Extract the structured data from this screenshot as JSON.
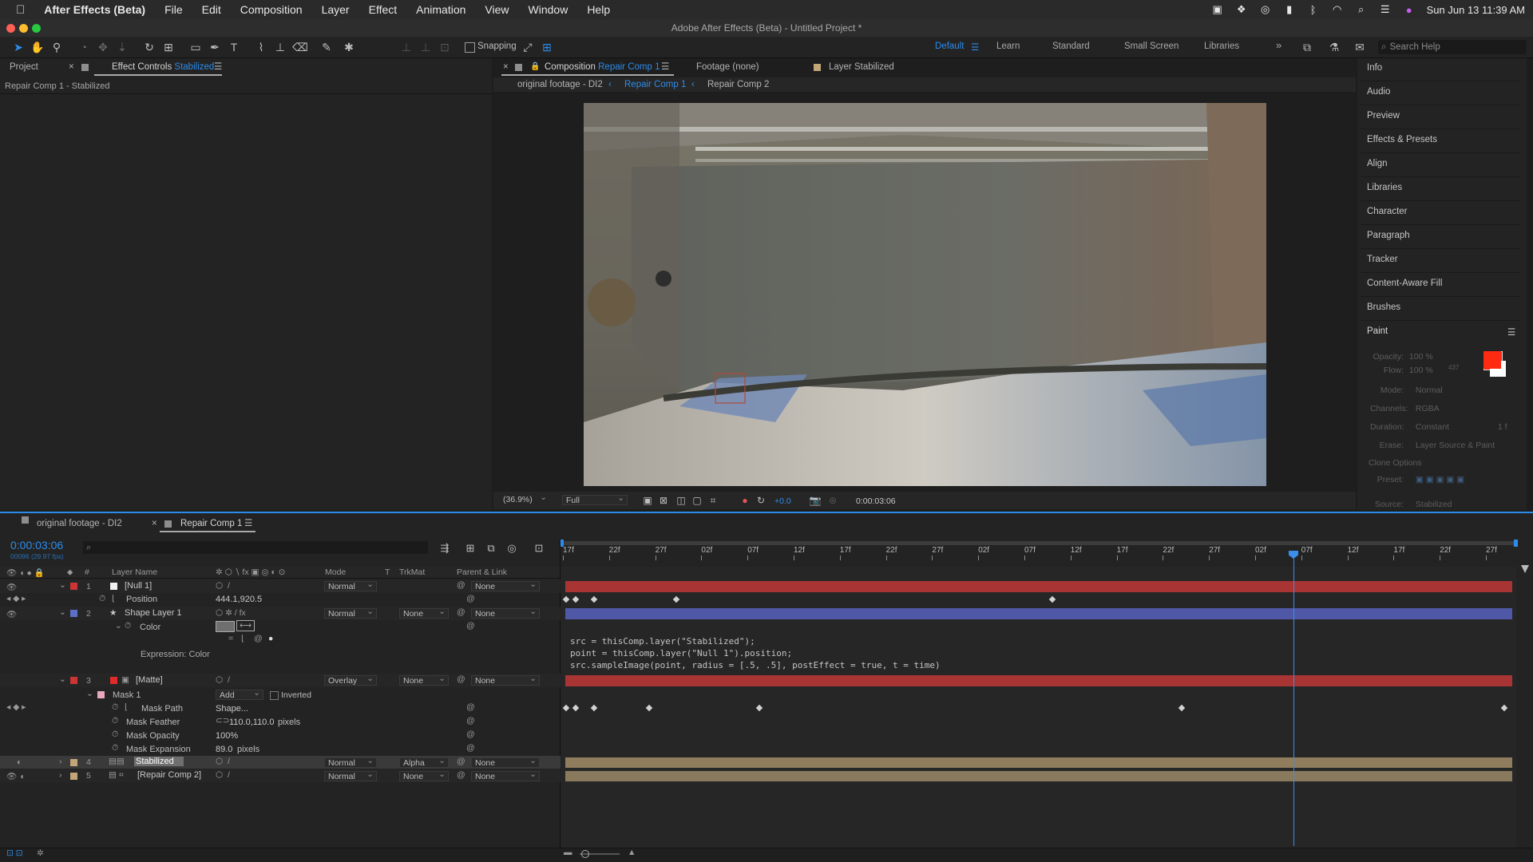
{
  "menubar": {
    "items": [
      "After Effects (Beta)",
      "File",
      "Edit",
      "Composition",
      "Layer",
      "Effect",
      "Animation",
      "View",
      "Window",
      "Help"
    ],
    "datetime": "Sun Jun 13  11:39 AM"
  },
  "window_title": "Adobe After Effects (Beta) - Untitled Project *",
  "toolbar": {
    "snapping_label": "Snapping",
    "workspaces": [
      "Default",
      "Learn",
      "Standard",
      "Small Screen",
      "Libraries"
    ],
    "active_workspace": "Default",
    "search_placeholder": "Search Help"
  },
  "left_panel": {
    "tab_project": "Project",
    "tab_effect_controls": "Effect Controls",
    "tab_effect_controls_layer": "Stabilized",
    "subtitle": "Repair Comp 1 - Stabilized"
  },
  "comp_panel": {
    "tab_composition": "Composition",
    "tab_composition_name": "Repair Comp 1",
    "tab_footage": "Footage (none)",
    "tab_layer": "Layer Stabilized",
    "breadcrumbs": [
      "original footage - DI2",
      "Repair Comp 1",
      "Repair Comp 2"
    ],
    "zoom": "(36.9%)",
    "resolution": "Full",
    "exposure": "+0.0",
    "timecode": "0:00:03:06"
  },
  "right_panel": {
    "items": [
      "Info",
      "Audio",
      "Preview",
      "Effects & Presets",
      "Align",
      "Libraries",
      "Character",
      "Paragraph",
      "Tracker",
      "Content-Aware Fill",
      "Brushes",
      "Paint"
    ],
    "paint": {
      "opacity_label": "Opacity:",
      "opacity_value": "100 %",
      "flow_label": "Flow:",
      "flow_value": "100 %",
      "brush_size": "437",
      "mode_label": "Mode:",
      "mode_value": "Normal",
      "channels_label": "Channels:",
      "channels_value": "RGBA",
      "duration_label": "Duration:",
      "duration_value": "Constant",
      "duration_frames": "1 f",
      "erase_label": "Erase:",
      "erase_value": "Layer Source & Paint",
      "clone_options": "Clone Options",
      "preset_label": "Preset:",
      "source_label": "Source:",
      "source_value": "Stabilized",
      "foreground_color": "#ff2a12",
      "background_color": "#ffffff"
    }
  },
  "timeline": {
    "tabs": [
      "original footage - DI2",
      "Repair Comp 1"
    ],
    "timecode": "0:00:03:06",
    "frame_info": "00096 (29.97 fps)",
    "columns": {
      "layer_name": "Layer Name",
      "mode": "Mode",
      "t": "T",
      "trkmat": "TrkMat",
      "parent": "Parent & Link",
      "index": "#"
    },
    "ruler_ticks": [
      "17f",
      "22f",
      "27f",
      "02f",
      "07f",
      "12f",
      "17f",
      "22f",
      "27f",
      "02f",
      "07f",
      "12f",
      "17f",
      "22f",
      "27f",
      "02f",
      "07f",
      "12f",
      "17f",
      "22f",
      "27f"
    ],
    "layers": [
      {
        "index": "1",
        "name": "[Null 1]",
        "mode": "Normal",
        "trkmat": "",
        "parent": "None",
        "label_color": "#cc3535",
        "bar_color": "#a83434"
      },
      {
        "index": "2",
        "name": "Shape Layer 1",
        "mode": "Normal",
        "trkmat": "None",
        "parent": "None",
        "label_color": "#5d70c9",
        "bar_color": "#4f58a6"
      },
      {
        "index": "3",
        "name": "[Matte]",
        "mode": "Overlay",
        "trkmat": "None",
        "parent": "None",
        "label_color": "#cc3535",
        "bar_color": "#a83434"
      },
      {
        "index": "4",
        "name": "Stabilized",
        "mode": "Normal",
        "trkmat": "Alpha",
        "parent": "None",
        "label_color": "#c3a677",
        "bar_color": "#8f7d5e"
      },
      {
        "index": "5",
        "name": "[Repair Comp 2]",
        "mode": "Normal",
        "trkmat": "None",
        "parent": "None",
        "label_color": "#c3a677",
        "bar_color": "#8f7d5e"
      }
    ],
    "position_label": "Position",
    "position_value": "444.1,920.5",
    "color_label": "Color",
    "expression_label": "Expression: Color",
    "expression_lines": [
      "src = thisComp.layer(\"Stabilized\");",
      "point = thisComp.layer(\"Null 1\").position;",
      "src.sampleImage(point, radius = [.5, .5], postEffect = true, t = time)"
    ],
    "mask": {
      "name": "Mask 1",
      "mode": "Add",
      "inverted_label": "Inverted",
      "path_label": "Mask Path",
      "path_value": "Shape...",
      "feather_label": "Mask Feather",
      "feather_value": "110.0,110.0",
      "feather_unit": "pixels",
      "opacity_label": "Mask Opacity",
      "opacity_value": "100%",
      "expansion_label": "Mask Expansion",
      "expansion_value": "89.0",
      "expansion_unit": "pixels"
    }
  }
}
